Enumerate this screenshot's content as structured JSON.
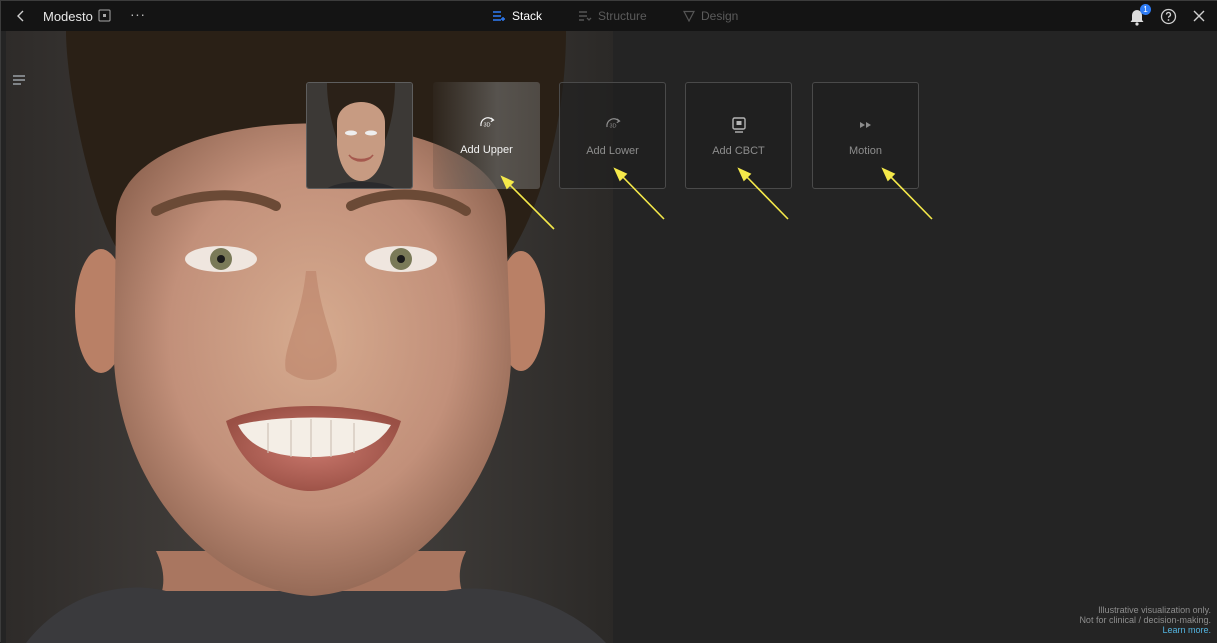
{
  "topbar": {
    "title": "Modesto",
    "more": "···",
    "tabs": [
      {
        "label": "Stack",
        "active": true
      },
      {
        "label": "Structure",
        "active": false
      },
      {
        "label": "Design",
        "active": false
      }
    ],
    "notification_count": "1",
    "accent_color": "#2e7cf6"
  },
  "tiles": [
    {
      "label": "Add Upper",
      "icon": "3d-rotate-icon",
      "highlighted": true
    },
    {
      "label": "Add Lower",
      "icon": "3d-rotate-icon",
      "highlighted": false
    },
    {
      "label": "Add CBCT",
      "icon": "cbct-scan-icon",
      "highlighted": false
    },
    {
      "label": "Motion",
      "icon": "fast-forward-icon",
      "highlighted": false
    }
  ],
  "icons": {
    "back": "chevron-left-icon",
    "square": "square-icon",
    "bell": "bell-icon",
    "help": "help-icon",
    "close": "close-icon",
    "menu": "hamburger-menu-icon"
  },
  "annotation_color": "#f5e94a",
  "disclaimer": {
    "line1": "Illustrative visualization only.",
    "line2": "Not for clinical / decision-making.",
    "link": "Learn more."
  }
}
